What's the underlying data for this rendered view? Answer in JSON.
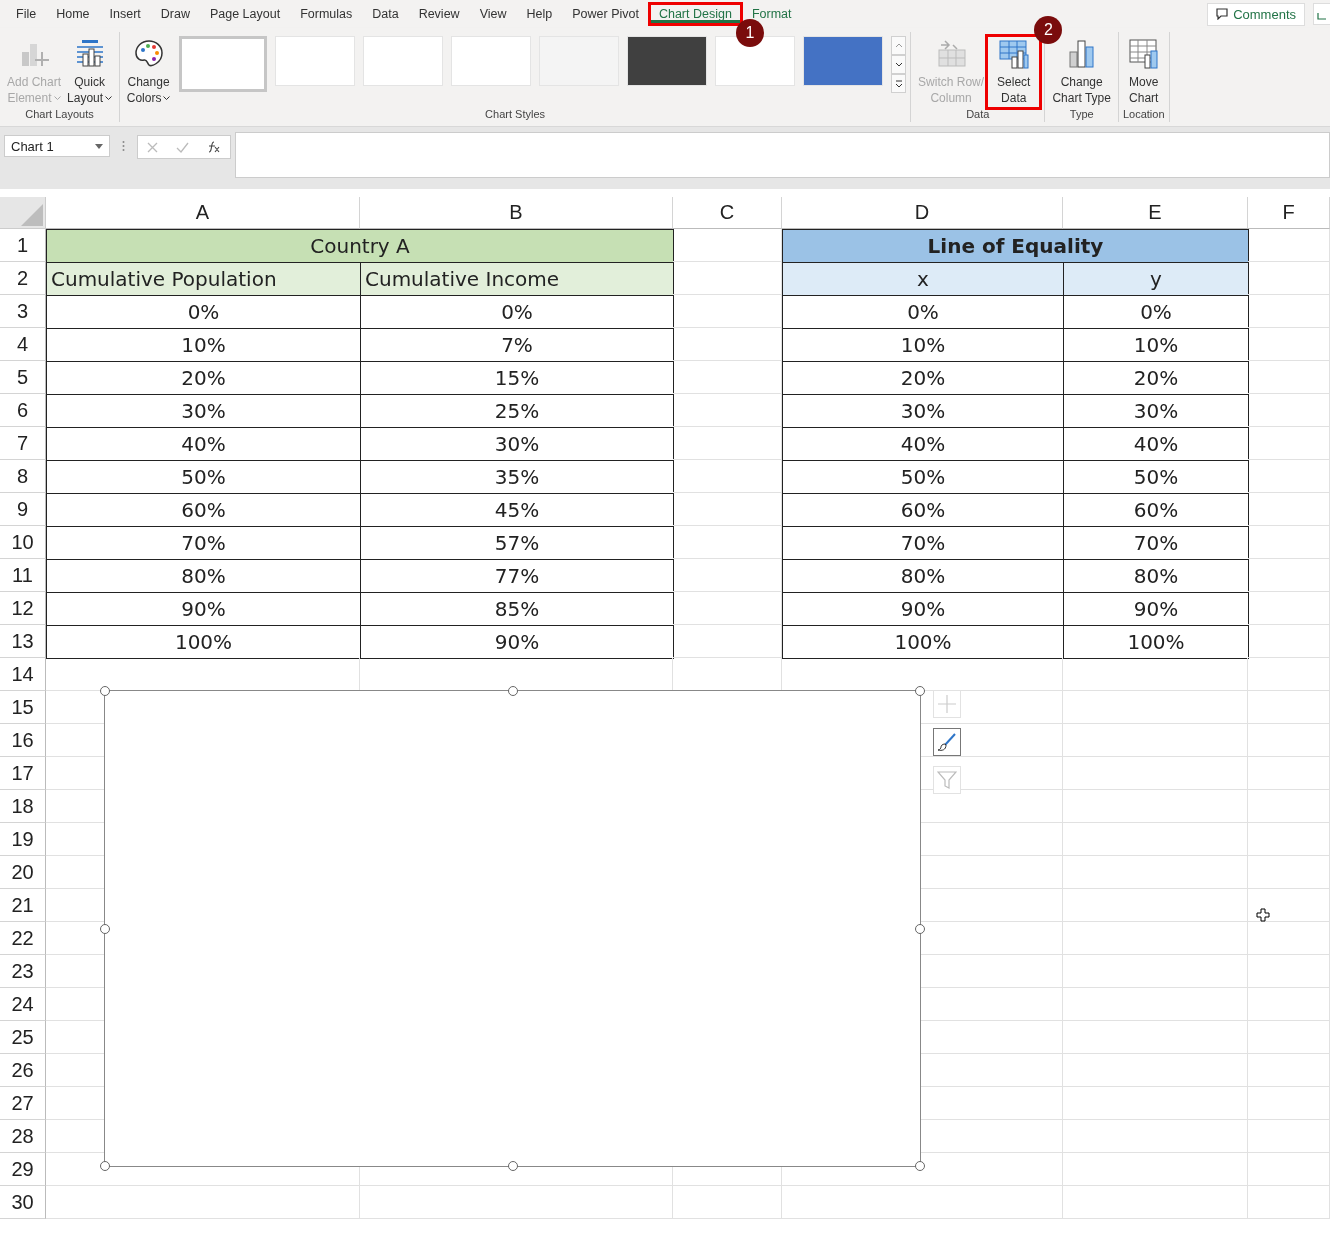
{
  "menu_tabs": [
    {
      "label": "File",
      "selected": false,
      "contextual": false,
      "highlighted": false
    },
    {
      "label": "Home",
      "selected": false,
      "contextual": false,
      "highlighted": false
    },
    {
      "label": "Insert",
      "selected": false,
      "contextual": false,
      "highlighted": false
    },
    {
      "label": "Draw",
      "selected": false,
      "contextual": false,
      "highlighted": false
    },
    {
      "label": "Page Layout",
      "selected": false,
      "contextual": false,
      "highlighted": false
    },
    {
      "label": "Formulas",
      "selected": false,
      "contextual": false,
      "highlighted": false
    },
    {
      "label": "Data",
      "selected": false,
      "contextual": false,
      "highlighted": false
    },
    {
      "label": "Review",
      "selected": false,
      "contextual": false,
      "highlighted": false
    },
    {
      "label": "View",
      "selected": false,
      "contextual": false,
      "highlighted": false
    },
    {
      "label": "Help",
      "selected": false,
      "contextual": false,
      "highlighted": false
    },
    {
      "label": "Power Pivot",
      "selected": false,
      "contextual": false,
      "highlighted": false
    },
    {
      "label": "Chart Design",
      "selected": true,
      "contextual": true,
      "highlighted": true,
      "callout": "1"
    },
    {
      "label": "Format",
      "selected": false,
      "contextual": true,
      "highlighted": false
    }
  ],
  "comments_button": "Comments",
  "ribbon_groups": [
    {
      "label": "Chart Layouts",
      "buttons": [
        {
          "kind": "add-element",
          "lines": [
            "Add Chart",
            "Element"
          ],
          "dropdown": true,
          "disabled": true,
          "highlighted": false
        },
        {
          "kind": "quick-layout",
          "lines": [
            "Quick",
            "Layout"
          ],
          "dropdown": true,
          "disabled": false,
          "highlighted": false
        }
      ]
    },
    {
      "label": "Chart Styles",
      "buttons": [
        {
          "kind": "palette",
          "lines": [
            "Change",
            "Colors"
          ],
          "dropdown": true,
          "disabled": false,
          "highlighted": false
        }
      ],
      "styles": [
        {
          "color": "#ffffff",
          "selected": true
        },
        {
          "color": "#ffffff",
          "selected": false
        },
        {
          "color": "#ffffff",
          "selected": false
        },
        {
          "color": "#ffffff",
          "selected": false
        },
        {
          "color": "#f4f4f4",
          "selected": false
        },
        {
          "color": "#404040",
          "selected": false
        },
        {
          "color": "#ffffff",
          "selected": false
        },
        {
          "color": "#4472c4",
          "selected": false
        }
      ]
    },
    {
      "label": "Data",
      "buttons": [
        {
          "kind": "switch",
          "lines": [
            "Switch Row/",
            "Column"
          ],
          "dropdown": false,
          "disabled": true,
          "highlighted": false
        },
        {
          "kind": "select-data",
          "lines": [
            "Select",
            "Data"
          ],
          "dropdown": false,
          "disabled": false,
          "highlighted": true,
          "callout": "2"
        }
      ]
    },
    {
      "label": "Type",
      "buttons": [
        {
          "kind": "change-type",
          "lines": [
            "Change",
            "Chart Type"
          ],
          "dropdown": false,
          "disabled": false,
          "highlighted": false
        }
      ]
    },
    {
      "label": "Location",
      "buttons": [
        {
          "kind": "move",
          "lines": [
            "Move",
            "Chart"
          ],
          "dropdown": false,
          "disabled": false,
          "highlighted": false
        }
      ]
    }
  ],
  "name_box": "Chart 1",
  "sheet": {
    "columns": [
      "A",
      "B",
      "C",
      "D",
      "E",
      "F"
    ],
    "rows": [
      {
        "number": "1",
        "cells": [
          {
            "text": "Country A",
            "kind": "green-title"
          },
          {
            "kind": "empty"
          },
          {
            "text": "Line of Equality",
            "kind": "blue-title"
          },
          {
            "kind": "empty"
          }
        ]
      },
      {
        "number": "2",
        "cells": [
          {
            "text": "Cumulative Population",
            "kind": "green-header"
          },
          {
            "text": "Cumulative Income",
            "kind": "green-header"
          },
          {
            "kind": "empty"
          },
          {
            "text": "x",
            "kind": "blue-header"
          },
          {
            "text": "y",
            "kind": "blue-header"
          },
          {
            "kind": "empty"
          }
        ]
      },
      {
        "number": "3",
        "cells": [
          {
            "text": "0%",
            "kind": "data"
          },
          {
            "text": "0%",
            "kind": "data"
          },
          {
            "kind": "empty"
          },
          {
            "text": "0%",
            "kind": "data"
          },
          {
            "text": "0%",
            "kind": "data"
          },
          {
            "kind": "empty"
          }
        ]
      },
      {
        "number": "4",
        "cells": [
          {
            "text": "10%",
            "kind": "data"
          },
          {
            "text": "7%",
            "kind": "data"
          },
          {
            "kind": "empty"
          },
          {
            "text": "10%",
            "kind": "data"
          },
          {
            "text": "10%",
            "kind": "data"
          },
          {
            "kind": "empty"
          }
        ]
      },
      {
        "number": "5",
        "cells": [
          {
            "text": "20%",
            "kind": "data"
          },
          {
            "text": "15%",
            "kind": "data"
          },
          {
            "kind": "empty"
          },
          {
            "text": "20%",
            "kind": "data"
          },
          {
            "text": "20%",
            "kind": "data"
          },
          {
            "kind": "empty"
          }
        ]
      },
      {
        "number": "6",
        "cells": [
          {
            "text": "30%",
            "kind": "data"
          },
          {
            "text": "25%",
            "kind": "data"
          },
          {
            "kind": "empty"
          },
          {
            "text": "30%",
            "kind": "data"
          },
          {
            "text": "30%",
            "kind": "data"
          },
          {
            "kind": "empty"
          }
        ]
      },
      {
        "number": "7",
        "cells": [
          {
            "text": "40%",
            "kind": "data"
          },
          {
            "text": "30%",
            "kind": "data"
          },
          {
            "kind": "empty"
          },
          {
            "text": "40%",
            "kind": "data"
          },
          {
            "text": "40%",
            "kind": "data"
          },
          {
            "kind": "empty"
          }
        ]
      },
      {
        "number": "8",
        "cells": [
          {
            "text": "50%",
            "kind": "data"
          },
          {
            "text": "35%",
            "kind": "data"
          },
          {
            "kind": "empty"
          },
          {
            "text": "50%",
            "kind": "data"
          },
          {
            "text": "50%",
            "kind": "data"
          },
          {
            "kind": "empty"
          }
        ]
      },
      {
        "number": "9",
        "cells": [
          {
            "text": "60%",
            "kind": "data"
          },
          {
            "text": "45%",
            "kind": "data"
          },
          {
            "kind": "empty"
          },
          {
            "text": "60%",
            "kind": "data"
          },
          {
            "text": "60%",
            "kind": "data"
          },
          {
            "kind": "empty"
          }
        ]
      },
      {
        "number": "10",
        "cells": [
          {
            "text": "70%",
            "kind": "data"
          },
          {
            "text": "57%",
            "kind": "data"
          },
          {
            "kind": "empty"
          },
          {
            "text": "70%",
            "kind": "data"
          },
          {
            "text": "70%",
            "kind": "data"
          },
          {
            "kind": "empty"
          }
        ]
      },
      {
        "number": "11",
        "cells": [
          {
            "text": "80%",
            "kind": "data"
          },
          {
            "text": "77%",
            "kind": "data"
          },
          {
            "kind": "empty"
          },
          {
            "text": "80%",
            "kind": "data"
          },
          {
            "text": "80%",
            "kind": "data"
          },
          {
            "kind": "empty"
          }
        ]
      },
      {
        "number": "12",
        "cells": [
          {
            "text": "90%",
            "kind": "data"
          },
          {
            "text": "85%",
            "kind": "data"
          },
          {
            "kind": "empty"
          },
          {
            "text": "90%",
            "kind": "data"
          },
          {
            "text": "90%",
            "kind": "data"
          },
          {
            "kind": "empty"
          }
        ]
      },
      {
        "number": "13",
        "cells": [
          {
            "text": "100%",
            "kind": "data"
          },
          {
            "text": "90%",
            "kind": "data"
          },
          {
            "kind": "empty"
          },
          {
            "text": "100%",
            "kind": "data"
          },
          {
            "text": "100%",
            "kind": "data"
          },
          {
            "kind": "empty"
          }
        ]
      },
      {
        "number": "14"
      },
      {
        "number": "15"
      },
      {
        "number": "16"
      },
      {
        "number": "17"
      },
      {
        "number": "18"
      },
      {
        "number": "19"
      },
      {
        "number": "20"
      },
      {
        "number": "21"
      },
      {
        "number": "22"
      },
      {
        "number": "23"
      },
      {
        "number": "24"
      },
      {
        "number": "25"
      },
      {
        "number": "26"
      },
      {
        "number": "27"
      },
      {
        "number": "28"
      },
      {
        "number": "29"
      },
      {
        "number": "30"
      }
    ]
  },
  "chart": {
    "kind": "empty-chart",
    "selected": true
  }
}
